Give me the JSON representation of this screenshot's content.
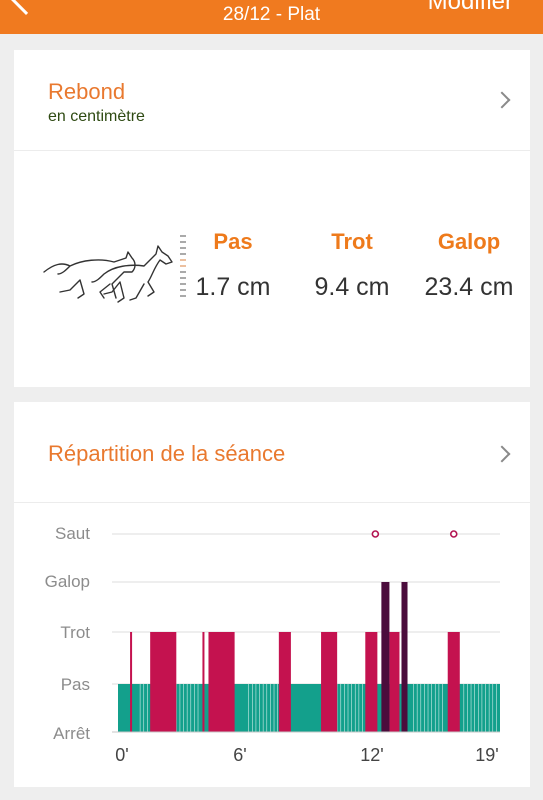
{
  "header": {
    "title": "28/12 - Plat",
    "action_label": "Modifier",
    "back_icon": "chevron-left-icon"
  },
  "rebond": {
    "title": "Rebond",
    "subtitle": "en centimètre",
    "icon": "horses-galloping-icon",
    "gaits": [
      {
        "name": "Pas",
        "value": "1.7 cm"
      },
      {
        "name": "Trot",
        "value": "9.4 cm"
      },
      {
        "name": "Galop",
        "value": "23.4 cm"
      }
    ]
  },
  "repartition": {
    "title": "Répartition de la séance"
  },
  "colors": {
    "accent": "#ee7a1b",
    "pas": "#13a08c",
    "trot": "#c4124f",
    "galop": "#4b0c3c",
    "saut": "#b31552"
  },
  "chart_data": {
    "type": "timeline",
    "y_levels": [
      "Arrêt",
      "Pas",
      "Trot",
      "Galop",
      "Saut"
    ],
    "x_ticks": [
      "0'",
      "6'",
      "12'",
      "19'"
    ],
    "x_range_minutes": [
      0,
      19
    ],
    "pas_span": [
      0,
      19
    ],
    "trot_segments": [
      [
        0.6,
        0.7
      ],
      [
        1.6,
        2.9
      ],
      [
        4.2,
        4.3
      ],
      [
        4.5,
        5.8
      ],
      [
        8.0,
        8.6
      ],
      [
        10.1,
        10.9
      ],
      [
        12.3,
        12.9
      ],
      [
        13.5,
        14.0
      ],
      [
        16.4,
        17.0
      ]
    ],
    "galop_segments": [
      [
        13.1,
        13.5
      ],
      [
        14.1,
        14.4
      ]
    ],
    "saut_points": [
      12.8,
      16.7
    ]
  }
}
